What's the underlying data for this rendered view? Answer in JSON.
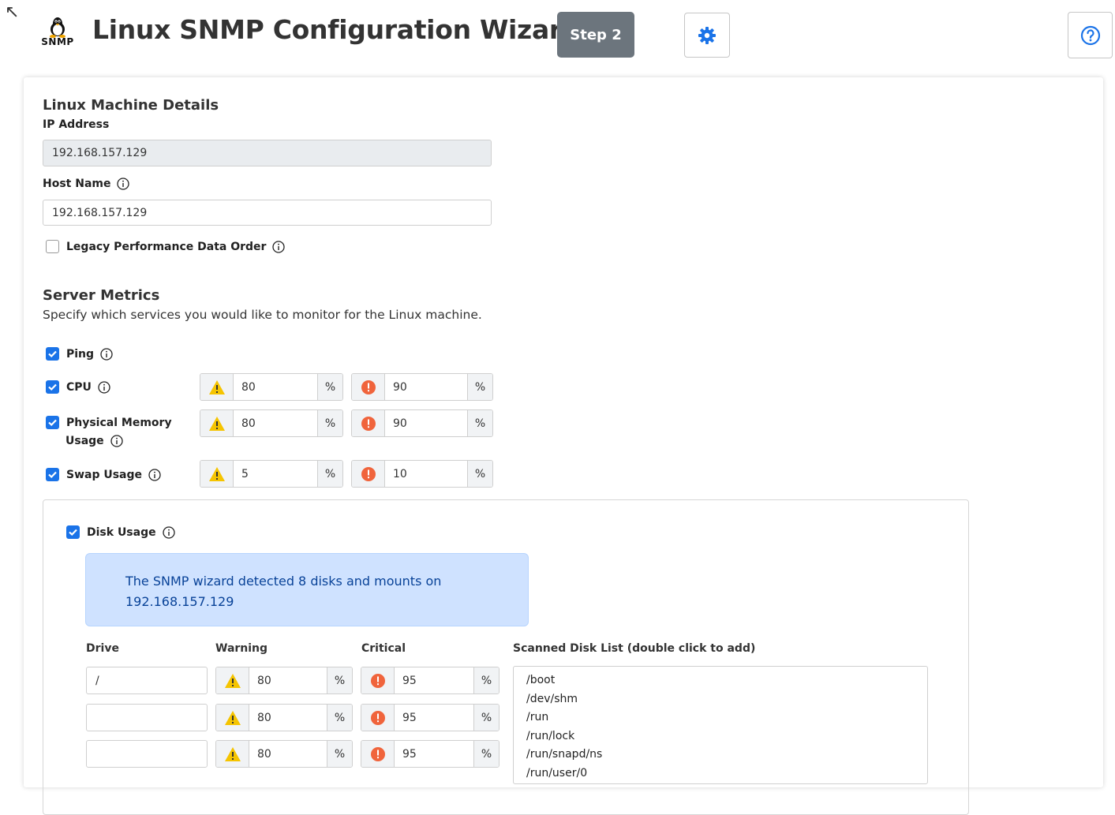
{
  "header": {
    "logo_text": "SNMP",
    "title": "Linux SNMP Configuration Wizard",
    "step_label": "Step 2",
    "settings_icon": "gear-icon",
    "help_icon": "question-circle-icon"
  },
  "machine": {
    "section_title": "Linux Machine Details",
    "ip_label": "IP Address",
    "ip_value": "192.168.157.129",
    "host_label": "Host Name",
    "host_value": "192.168.157.129",
    "legacy_label": "Legacy Performance Data Order",
    "legacy_checked": false
  },
  "metrics": {
    "section_title": "Server Metrics",
    "description": "Specify which services you would like to monitor for the Linux machine.",
    "ping_label": "Ping",
    "cpu": {
      "label": "CPU",
      "warning": "80",
      "critical": "90",
      "unit": "%"
    },
    "memory": {
      "label_line1": "Physical Memory",
      "label_line2": "Usage",
      "warning": "80",
      "critical": "90",
      "unit": "%"
    },
    "swap": {
      "label": "Swap Usage",
      "warning": "5",
      "critical": "10",
      "unit": "%"
    }
  },
  "disk": {
    "label": "Disk Usage",
    "alert_text": "The SNMP wizard detected 8 disks and mounts on 192.168.157.129",
    "col_drive": "Drive",
    "col_warning": "Warning",
    "col_critical": "Critical",
    "col_scanned": "Scanned Disk List  (double click to add)",
    "rows": [
      {
        "drive": "/",
        "warning": "80",
        "critical": "95",
        "unit": "%"
      },
      {
        "drive": "",
        "warning": "80",
        "critical": "95",
        "unit": "%"
      },
      {
        "drive": "",
        "warning": "80",
        "critical": "95",
        "unit": "%"
      }
    ],
    "scanned_list": [
      "/boot",
      "/dev/shm",
      "/run",
      "/run/lock",
      "/run/snapd/ns",
      "/run/user/0"
    ]
  },
  "colors": {
    "primary": "#1a73e8",
    "warning": "#f5c400",
    "critical": "#f0643c",
    "step_badge": "#6c757d",
    "alert_bg": "#cfe2ff"
  }
}
